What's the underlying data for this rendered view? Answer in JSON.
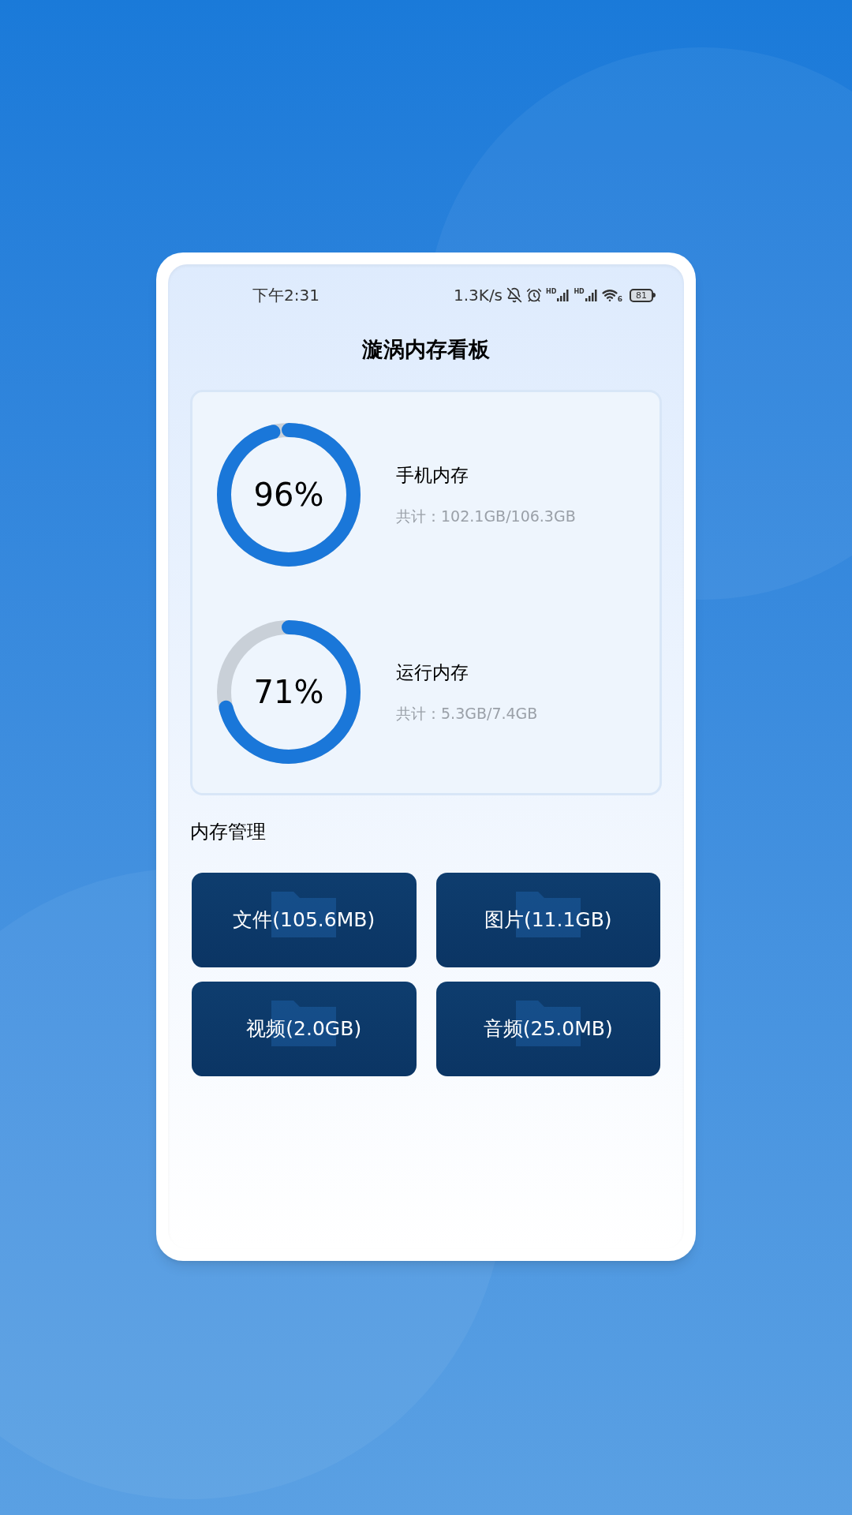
{
  "status_bar": {
    "time": "下午2:31",
    "speed": "1.3K/s",
    "signals": [
      {
        "label": "HD"
      },
      {
        "label": "HD"
      }
    ],
    "wifi_label": "6",
    "battery": "81"
  },
  "title": "漩涡内存看板",
  "gauges": [
    {
      "percent": "96%",
      "level": 0.96,
      "name": "手机内存",
      "detail": "共计：102.1GB/106.3GB"
    },
    {
      "percent": "71%",
      "level": 0.71,
      "name": "运行内存",
      "detail": "共计：5.3GB/7.4GB"
    }
  ],
  "section_title": "内存管理",
  "buttons": [
    "文件(105.6MB)",
    "图片(11.1GB)",
    "视频(2.0GB)",
    "音频(25.0MB)"
  ]
}
